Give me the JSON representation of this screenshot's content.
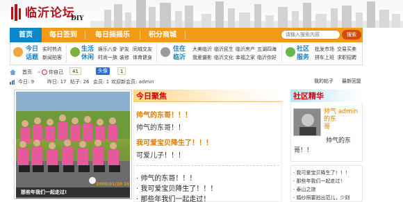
{
  "header": {
    "logo_text": "临沂论坛",
    "logo_suffix": "DIY"
  },
  "nav": {
    "items": [
      {
        "label": "首页"
      },
      {
        "label": "每日签到"
      },
      {
        "label": "每日摇摇乐"
      },
      {
        "label": "积分商城"
      }
    ],
    "search_placeholder": "请输入搜索内容",
    "search_button": "搜索"
  },
  "categories": [
    {
      "title_line1": "今日",
      "title_line2": "话题",
      "links_row1": [
        "实时热点"
      ],
      "links_row2": [
        "新闻拍客"
      ]
    },
    {
      "title_line1": "生活",
      "title_line2": "休闲",
      "links_row1": [
        "娱乐八卦",
        "驴友",
        "同城交友"
      ],
      "links_row2": [
        "时尚一族",
        "装修",
        "体育健身"
      ]
    },
    {
      "title_line1": "住在",
      "title_line2": "临沂",
      "links_row1": [
        "大美临沂",
        "临沂民生",
        "临沂房产",
        "五湖四海"
      ],
      "links_row2": [
        "我爱摄影",
        "临沂文化",
        "幸福之家",
        "临沂你好"
      ]
    },
    {
      "title_line1": "社区",
      "title_line2": "服务",
      "links_row1": [
        "批发市场",
        "交易买卖"
      ],
      "links_row2": [
        "拼车上班",
        "求职招聘"
      ]
    }
  ],
  "crumb": {
    "home": "首页",
    "crumb_sep": "»",
    "user": "你自己",
    "count": "41",
    "badge": "头像",
    "badge_count": "1"
  },
  "stats": {
    "today": "今日: 9",
    "yesterday": "昨日: 17",
    "posts": "帖子: 26",
    "members": "会员: 1",
    "welcome": "欢迎新会员: admin",
    "my_posts": "我的帖子",
    "latest_reply": "最新回复"
  },
  "photo": {
    "caption": "那些年我们一起走过!",
    "date": "2009/01/20 16"
  },
  "focus": {
    "title": "今日聚焦",
    "headline1": "帅气的东哥！！！",
    "sub1": "帅气的东哥！！",
    "headline2": "我可爱宝贝降生了！！！",
    "sub2": "可爱儿子！！！",
    "list": [
      "帅气的东哥！！！",
      "我可爱宝贝降生了！！！",
      "那些年我们一起走过！"
    ]
  },
  "community": {
    "title": "社区精华",
    "user_line1": "帅气",
    "user_line2": "admin",
    "user_line3": "的东",
    "user_line4": "哥",
    "text_line1": "帅气的东",
    "text_line2": "哥！！",
    "list": [
      "我可爱宝贝降生了！！！",
      "那些年我们一起走过！",
      "泰山之旅",
      "婚纱照要拍出范儿，少则"
    ]
  },
  "colors": {
    "nav_orange": "#f39a17",
    "nav_home_blue": "#0a86c9",
    "title_red": "#d40000",
    "link_orange": "#e07a00",
    "category_blue": "#1a7fc4"
  }
}
